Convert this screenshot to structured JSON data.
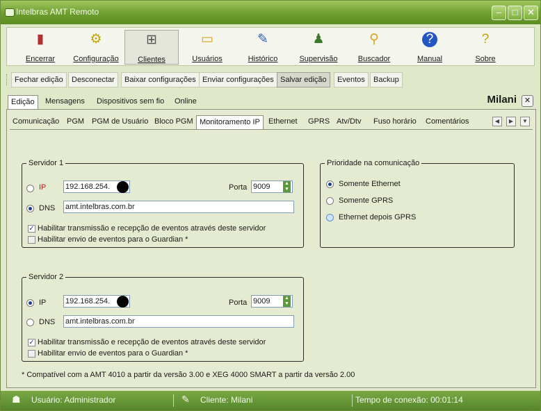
{
  "window": {
    "title": "Intelbras AMT Remoto"
  },
  "toolbar": [
    {
      "label": "Encerrar",
      "icon": "door-icon"
    },
    {
      "label": "Configuração",
      "icon": "config-gear-icon"
    },
    {
      "label": "Clientes",
      "icon": "clients-network-icon"
    },
    {
      "label": "Usuários",
      "icon": "folder-icon"
    },
    {
      "label": "Histórico",
      "icon": "notepad-icon"
    },
    {
      "label": "Supervisão",
      "icon": "people-icon"
    },
    {
      "label": "Buscador",
      "icon": "magnifier-icon"
    },
    {
      "label": "Manual",
      "icon": "help-icon"
    },
    {
      "label": "Sobre",
      "icon": "info-icon"
    }
  ],
  "actions": [
    "Fechar edição",
    "Desconectar",
    "Baixar configurações",
    "Enviar configurações",
    "Salvar edição",
    "Eventos",
    "Backup"
  ],
  "tabs_main": [
    "Edição",
    "Mensagens",
    "Dispositivos sem fio",
    "Online"
  ],
  "client_name": "Milani",
  "tabs_sub": [
    "Comunicação",
    "PGM",
    "PGM de Usuário",
    "Bloco PGM",
    "Monitoramento IP",
    "Ethernet",
    "GPRS",
    "Atv/Dtv",
    "Fuso horário",
    "Comentários"
  ],
  "server1": {
    "legend": "Servidor 1",
    "ip_label": "IP",
    "ip_value": "192.168.254.",
    "port_label": "Porta",
    "port_value": "9009",
    "dns_label": "DNS",
    "dns_value": "amt.intelbras.com.br",
    "check1": "Habilitar transmissão e recepção de eventos através deste servidor",
    "check2": "Habilitar envio de eventos para o Guardian *"
  },
  "server2": {
    "legend": "Servidor 2",
    "ip_label": "IP",
    "ip_value": "192.168.254.",
    "port_label": "Porta",
    "port_value": "9009",
    "dns_label": "DNS",
    "dns_value": "amt.intelbras.com.br",
    "check1": "Habilitar transmissão e recepção de eventos através deste servidor",
    "check2": "Habilitar envio de eventos para o Guardian *"
  },
  "priority": {
    "legend": "Prioridade na comunicação",
    "options": [
      "Somente Ethernet",
      "Somente GPRS",
      "Ethernet depois GPRS"
    ]
  },
  "footnote": "* Compatível com a AMT 4010 a partir da versão 3.00 e XEG 4000 SMART a partir da versão 2.00",
  "status": {
    "user": "Usuário: Administrador",
    "client": "Cliente: Milani",
    "time": "Tempo de conexão: 00:01:14"
  }
}
